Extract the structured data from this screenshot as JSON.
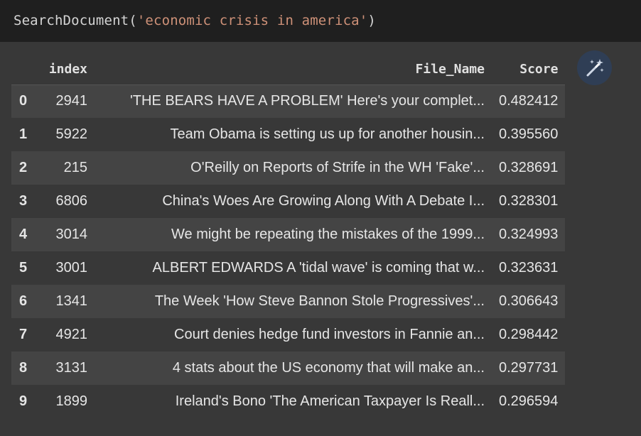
{
  "code": {
    "prefix": "SearchDocument(",
    "string_arg": "'economic crisis in america'",
    "suffix": ")"
  },
  "table": {
    "columns": [
      "",
      "index",
      "File_Name",
      "Score"
    ],
    "rows": [
      {
        "row": "0",
        "index": "2941",
        "file_name": "'THE BEARS HAVE A PROBLEM' Here's your complet...",
        "score": "0.482412"
      },
      {
        "row": "1",
        "index": "5922",
        "file_name": "Team Obama is setting us up for another housin...",
        "score": "0.395560"
      },
      {
        "row": "2",
        "index": "215",
        "file_name": "O'Reilly on Reports of Strife in the WH 'Fake'...",
        "score": "0.328691"
      },
      {
        "row": "3",
        "index": "6806",
        "file_name": "China's Woes Are Growing Along With A Debate I...",
        "score": "0.328301"
      },
      {
        "row": "4",
        "index": "3014",
        "file_name": "We might be repeating the mistakes of the 1999...",
        "score": "0.324993"
      },
      {
        "row": "5",
        "index": "3001",
        "file_name": "ALBERT EDWARDS A 'tidal wave' is coming that w...",
        "score": "0.323631"
      },
      {
        "row": "6",
        "index": "1341",
        "file_name": "The Week 'How Steve Bannon Stole Progressives'...",
        "score": "0.306643"
      },
      {
        "row": "7",
        "index": "4921",
        "file_name": "Court denies hedge fund investors in Fannie an...",
        "score": "0.298442"
      },
      {
        "row": "8",
        "index": "3131",
        "file_name": "4 stats about the US economy that will make an...",
        "score": "0.297731"
      },
      {
        "row": "9",
        "index": "1899",
        "file_name": "Ireland's Bono 'The American Taxpayer Is Reall...",
        "score": "0.296594"
      }
    ]
  },
  "magic_button": {
    "icon": "magic-wand-icon"
  },
  "colors": {
    "code_background": "#1f1f1f",
    "output_background": "#383838",
    "string_literal": "#ce9178",
    "alt_row": "#444444",
    "magic_button_bg": "#2f3e55"
  }
}
